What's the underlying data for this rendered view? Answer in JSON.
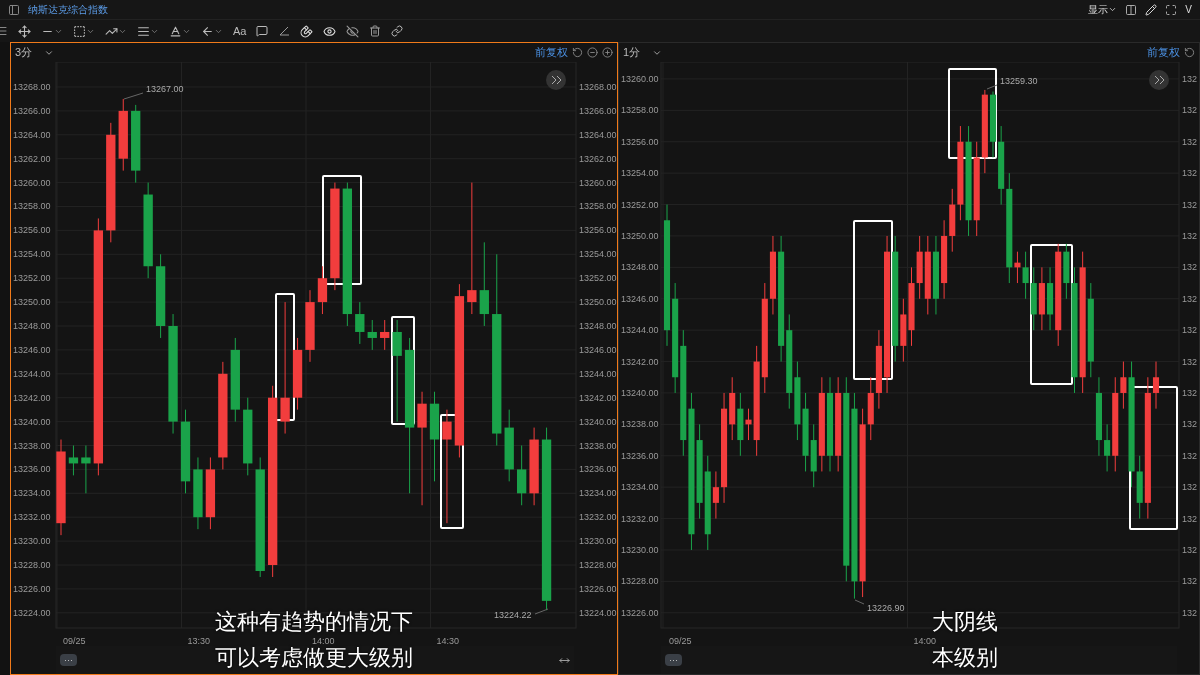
{
  "title": "纳斯达克综合指数",
  "toolbar": {
    "text_tool": "Aa"
  },
  "top_right": {
    "display_label": "显示",
    "cut_label": "V"
  },
  "panels": [
    {
      "selected": true,
      "interval": "3分",
      "adjust": "前复权",
      "chart_data": {
        "type": "candlestick",
        "ohlc": [
          [
            13231.5,
            13238.5,
            13230.5,
            13237.5
          ],
          [
            13237,
            13238,
            13235.5,
            13236.5
          ],
          [
            13237,
            13238,
            13234,
            13236.5
          ],
          [
            13236.5,
            13257,
            13235.5,
            13256
          ],
          [
            13256,
            13265,
            13255,
            13264
          ],
          [
            13262,
            13267,
            13261,
            13266
          ],
          [
            13266,
            13266.5,
            13260,
            13261
          ],
          [
            13259,
            13260,
            13252,
            13253
          ],
          [
            13253,
            13254,
            13247,
            13248
          ],
          [
            13248,
            13249,
            13239,
            13240
          ],
          [
            13240,
            13241,
            13234,
            13235
          ],
          [
            13236,
            13237,
            13231,
            13232
          ],
          [
            13232,
            13237,
            13231,
            13236
          ],
          [
            13237,
            13245,
            13236,
            13244
          ],
          [
            13246,
            13247,
            13240,
            13241
          ],
          [
            13241,
            13242,
            13235.5,
            13236.5
          ],
          [
            13236,
            13237,
            13227,
            13227.5
          ],
          [
            13228,
            13243,
            13227,
            13242
          ],
          [
            13240,
            13250,
            13239,
            13242
          ],
          [
            13242,
            13247,
            13241,
            13246
          ],
          [
            13246,
            13251,
            13245,
            13250
          ],
          [
            13250,
            13253,
            13249,
            13252
          ],
          [
            13252,
            13260,
            13251,
            13259.5
          ],
          [
            13259.5,
            13260,
            13248,
            13249
          ],
          [
            13249,
            13250,
            13246.5,
            13247.5
          ],
          [
            13247.5,
            13248.5,
            13246,
            13247
          ],
          [
            13247,
            13248.5,
            13246,
            13247.5
          ],
          [
            13247.5,
            13248.5,
            13240,
            13245.5
          ],
          [
            13246,
            13247,
            13234,
            13239.5
          ],
          [
            13239.5,
            13242.5,
            13233,
            13241.5
          ],
          [
            13241.5,
            13242.5,
            13235,
            13238.5
          ],
          [
            13238.5,
            13241,
            13231.5,
            13240
          ],
          [
            13238,
            13251.5,
            13237,
            13250.5
          ],
          [
            13250,
            13260,
            13249,
            13251
          ],
          [
            13251,
            13255,
            13248,
            13249
          ],
          [
            13249,
            13254,
            13238,
            13239
          ],
          [
            13239.5,
            13241,
            13235,
            13236
          ],
          [
            13236,
            13238,
            13233,
            13234
          ],
          [
            13234,
            13239.5,
            13233,
            13238.5
          ],
          [
            13238.5,
            13239.5,
            13224.22,
            13225
          ]
        ],
        "ylim": [
          13222.73,
          13270.09
        ],
        "grid": true,
        "yticks": [
          {
            "value": 13268,
            "label": "13268.00"
          },
          {
            "value": 13266,
            "label": "13266.00"
          },
          {
            "value": 13264,
            "label": "13264.00"
          },
          {
            "value": 13262,
            "label": "13262.00"
          },
          {
            "value": 13260,
            "label": "13260.00"
          },
          {
            "value": 13258,
            "label": "13258.00"
          },
          {
            "value": 13256,
            "label": "13256.00"
          },
          {
            "value": 13254,
            "label": "13254.00"
          },
          {
            "value": 13252,
            "label": "13252.00"
          },
          {
            "value": 13250,
            "label": "13250.00"
          },
          {
            "value": 13248,
            "label": "13248.00"
          },
          {
            "value": 13246,
            "label": "13246.00"
          },
          {
            "value": 13244,
            "label": "13244.00"
          },
          {
            "value": 13242,
            "label": "13242.00"
          },
          {
            "value": 13240,
            "label": "13240.00"
          },
          {
            "value": 13238,
            "label": "13238.00"
          },
          {
            "value": 13236,
            "label": "13236.00"
          },
          {
            "value": 13234,
            "label": "13234.00"
          },
          {
            "value": 13232,
            "label": "13232.00"
          },
          {
            "value": 13230,
            "label": "13230.00"
          },
          {
            "value": 13228,
            "label": "13228.00"
          },
          {
            "value": 13226,
            "label": "13226.00"
          },
          {
            "value": 13224,
            "label": "13224.00"
          }
        ]
      },
      "x_axis": [
        "09/25",
        "13:30",
        "14:00",
        "14:30"
      ],
      "right_axis": [
        "13268.00",
        "13266.00",
        "13264.00",
        "13262.00",
        "13260.00",
        "13258.00",
        "13256.00",
        "13254.00",
        "13252.00",
        "13250.00",
        "13248.00",
        "13246.00",
        "13244.00",
        "13242.00",
        "13240.00",
        "13238.00",
        "13236.00",
        "13234.00",
        "13232.00",
        "13230.00",
        "13228.00",
        "13226.00",
        "13224.00"
      ],
      "price_labels": [
        {
          "kind": "high",
          "text": "13267.00"
        },
        {
          "kind": "low",
          "text": "13224.22"
        }
      ],
      "more_label": "···",
      "subtitle": [
        "这种有趋势的情况下",
        "可以考虑做更大级别"
      ]
    },
    {
      "selected": false,
      "interval": "1分",
      "adjust": "前复权",
      "chart_data": {
        "type": "candlestick",
        "ohlc": [
          [
            13251,
            13252,
            13243,
            13244
          ],
          [
            13246,
            13247,
            13240,
            13241
          ],
          [
            13243,
            13244,
            13236,
            13237
          ],
          [
            13239,
            13240,
            13230,
            13231
          ],
          [
            13237,
            13238,
            13232,
            13233
          ],
          [
            13235,
            13236,
            13230,
            13231
          ],
          [
            13233,
            13235,
            13232,
            13234
          ],
          [
            13234,
            13240,
            13233,
            13239
          ],
          [
            13238,
            13241,
            13237,
            13240
          ],
          [
            13239,
            13240,
            13236,
            13237
          ],
          [
            13238,
            13239,
            13237,
            13238.3
          ],
          [
            13237,
            13243,
            13236,
            13242
          ],
          [
            13241,
            13247,
            13240,
            13246
          ],
          [
            13246,
            13250,
            13245,
            13249
          ],
          [
            13249,
            13250,
            13242,
            13243
          ],
          [
            13244,
            13245,
            13239,
            13240
          ],
          [
            13241,
            13242,
            13237,
            13238
          ],
          [
            13239,
            13240,
            13235,
            13236
          ],
          [
            13237,
            13238,
            13234,
            13235
          ],
          [
            13236,
            13241,
            13235,
            13240
          ],
          [
            13240,
            13241,
            13235,
            13236
          ],
          [
            13236,
            13241,
            13235,
            13240
          ],
          [
            13240,
            13241,
            13228,
            13229
          ],
          [
            13239,
            13240,
            13226.9,
            13228
          ],
          [
            13228,
            13239,
            13227,
            13238
          ],
          [
            13238,
            13241,
            13237,
            13240
          ],
          [
            13240,
            13244,
            13239,
            13243
          ],
          [
            13241,
            13250,
            13240,
            13249
          ],
          [
            13249,
            13250,
            13242,
            13243
          ],
          [
            13243,
            13246,
            13242,
            13245
          ],
          [
            13244,
            13248,
            13243,
            13247
          ],
          [
            13247,
            13250,
            13246,
            13249
          ],
          [
            13246,
            13250,
            13245,
            13249
          ],
          [
            13249,
            13250,
            13245,
            13246
          ],
          [
            13247,
            13251,
            13246,
            13250
          ],
          [
            13250,
            13253,
            13249,
            13252
          ],
          [
            13252,
            13257,
            13251,
            13256
          ],
          [
            13256,
            13257,
            13250,
            13251
          ],
          [
            13251,
            13256,
            13250,
            13255
          ],
          [
            13255,
            13259.3,
            13254,
            13259
          ],
          [
            13259,
            13259.2,
            13255,
            13256
          ],
          [
            13256,
            13257,
            13252,
            13253
          ],
          [
            13253,
            13254,
            13247,
            13248
          ],
          [
            13248,
            13249,
            13247,
            13248.3
          ],
          [
            13248,
            13249,
            13246,
            13247
          ],
          [
            13247,
            13248,
            13244,
            13245
          ],
          [
            13245,
            13248,
            13244,
            13247
          ],
          [
            13247,
            13248,
            13244,
            13245
          ],
          [
            13244,
            13249.5,
            13243,
            13249
          ],
          [
            13249,
            13249.5,
            13246,
            13247
          ],
          [
            13247,
            13248,
            13240,
            13241
          ],
          [
            13241,
            13249,
            13240,
            13248
          ],
          [
            13246,
            13247,
            13241,
            13242
          ],
          [
            13240,
            13241,
            13236,
            13237
          ],
          [
            13237,
            13238,
            13235,
            13236
          ],
          [
            13236,
            13241,
            13235,
            13240
          ],
          [
            13240,
            13242,
            13239,
            13241
          ],
          [
            13241,
            13242,
            13234,
            13235
          ],
          [
            13235,
            13236,
            13232,
            13233
          ],
          [
            13233,
            13241,
            13232,
            13240
          ],
          [
            13240,
            13242,
            13239,
            13241
          ]
        ],
        "ylim": [
          13225.03,
          13261.08
        ],
        "grid": true,
        "yticks": [
          {
            "value": 13260,
            "label": "13260.00"
          },
          {
            "value": 13258,
            "label": "13258.00"
          },
          {
            "value": 13256,
            "label": "13256.00"
          },
          {
            "value": 13254,
            "label": "13254.00"
          },
          {
            "value": 13252,
            "label": "13252.00"
          },
          {
            "value": 13250,
            "label": "13250.00"
          },
          {
            "value": 13248,
            "label": "13248.00"
          },
          {
            "value": 13246,
            "label": "13246.00"
          },
          {
            "value": 13244,
            "label": "13244.00"
          },
          {
            "value": 13242,
            "label": "13242.00"
          },
          {
            "value": 13240,
            "label": "13240.00"
          },
          {
            "value": 13238,
            "label": "13238.00"
          },
          {
            "value": 13236,
            "label": "13236.00"
          },
          {
            "value": 13234,
            "label": "13234.00"
          },
          {
            "value": 13232,
            "label": "13232.00"
          },
          {
            "value": 13230,
            "label": "13230.00"
          },
          {
            "value": 13228,
            "label": "13228.00"
          },
          {
            "value": 13226,
            "label": "13226.00"
          }
        ]
      },
      "x_axis": [
        "09/25",
        "14:00"
      ],
      "right_axis": [
        "132",
        "132",
        "132",
        "132",
        "132",
        "132",
        "132",
        "132",
        "132",
        "132",
        "132",
        "132",
        "132",
        "132",
        "132",
        "132",
        "132",
        "132"
      ],
      "price_labels": [
        {
          "kind": "high",
          "text": "13259.30"
        },
        {
          "kind": "low",
          "text": "13226.90"
        }
      ],
      "more_label": "···",
      "subtitle": [
        "大阴线",
        "本级别"
      ]
    }
  ]
}
